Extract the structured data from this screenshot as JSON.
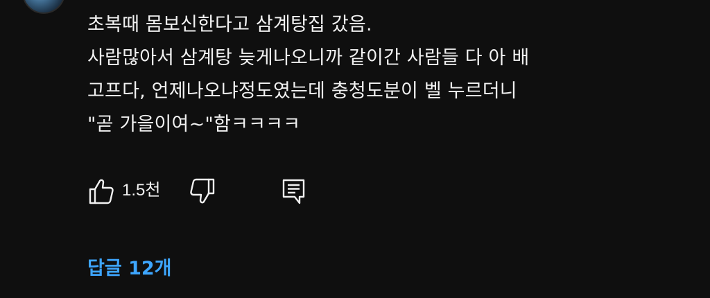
{
  "comment": {
    "lines": [
      "초복때 몸보신한다고 삼계탕집 갔음.",
      "사람많아서 삼계탕 늦게나오니까 같이간 사람들 다 아 배",
      "고프다, 언제나오냐정도였는데 충청도분이 벨 누르더니",
      "\"곧 가을이여~\"함ㅋㅋㅋㅋ"
    ]
  },
  "actions": {
    "like_count": "1.5천"
  },
  "replies": {
    "label": "답글 12개"
  },
  "colors": {
    "background": "#0f0f0f",
    "text": "#f1f1f1",
    "accent": "#3ea6ff"
  },
  "icons": {
    "like": "thumb-up-icon",
    "dislike": "thumb-down-icon",
    "reply": "comment-reply-icon",
    "more": "more-vertical-icon"
  }
}
